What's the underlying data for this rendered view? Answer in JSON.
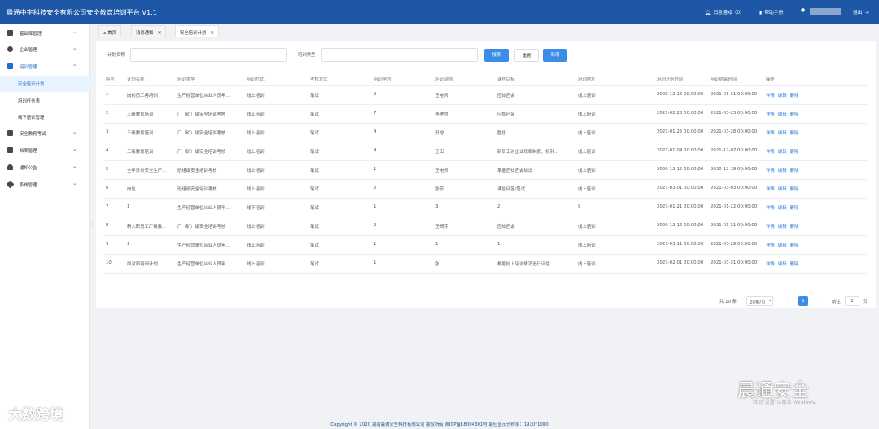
{
  "header": {
    "app_title": "晨通中宇科技安全有限公司安全教育培训平台 V1.1",
    "notifications": "消息通知（0）",
    "help": "帮助手册",
    "logout": "退出",
    "bg_color": "#1e57a6"
  },
  "sidebar": {
    "items": [
      {
        "label": "基础库管理",
        "icon": "database-icon"
      },
      {
        "label": "企业管理",
        "icon": "company-icon"
      },
      {
        "label": "培训管理",
        "icon": "training-icon",
        "open": true
      },
      {
        "label": "安全培训计划",
        "sub": true,
        "active": true
      },
      {
        "label": "培训任务表",
        "sub": true
      },
      {
        "label": "线下培训管理",
        "sub": true
      },
      {
        "label": "安全教育考试",
        "icon": "exam-icon"
      },
      {
        "label": "档案管理",
        "icon": "archive-icon"
      },
      {
        "label": "通知公告",
        "icon": "bell-icon"
      },
      {
        "label": "系统管理",
        "icon": "settings-icon"
      }
    ]
  },
  "tabs": [
    {
      "label": "首页",
      "icon": "home-icon"
    },
    {
      "label": "消息通知"
    },
    {
      "label": "安全培训计划",
      "active": true
    }
  ],
  "search": {
    "plan_name_label": "计划名称",
    "plan_name_value": "",
    "train_type_label": "培训类型",
    "train_type_value": "",
    "search_btn": "搜索",
    "reset_btn": "重置",
    "add_btn": "新增"
  },
  "table": {
    "columns": [
      "序号",
      "计划名称",
      "培训类型",
      "培训方式",
      "考核方式",
      "培训学时",
      "培训讲师",
      "课程目标",
      "培训地址",
      "培训开始时间",
      "培训结束时间",
      "操作"
    ],
    "rows": [
      [
        "1",
        "岗前员工再培训",
        "生产经营单位从业人员年...",
        "线上培训",
        "笔试",
        "2",
        "王老师",
        "应知应会",
        "线上培训",
        "2020-12-16 00:00:00",
        "2021-01-31 00:00:00"
      ],
      [
        "2",
        "三级教育培训",
        "厂（矿）级安全培训考核",
        "线上培训",
        "笔试",
        "7",
        "李老师",
        "应知应会",
        "线上培训",
        "2021-02-23 00:00:00",
        "2021-03-23 00:00:00"
      ],
      [
        "3",
        "三级教育培训",
        "厂（矿）级安全培训考核",
        "线上培训",
        "笔试",
        "4",
        "开总",
        "胜任",
        "线上培训",
        "2021-01-25 00:00:00",
        "2021-03-28 00:00:00"
      ],
      [
        "4",
        "三级教育培训",
        "厂（矿）级安全培训考核",
        "线上培训",
        "笔试",
        "4",
        "王五",
        "新员工对企业规章制度、权利...",
        "线上培训",
        "2021-01-04 00:00:00",
        "2021-12-07 00:00:00"
      ],
      [
        "5",
        "全年日常安全生产...",
        "班组级安全培训考核",
        "线上培训",
        "笔试",
        "1",
        "王老师",
        "掌握应知应会知识",
        "线上培训",
        "2020-12-15 00:00:00",
        "2020-12-18 00:00:00"
      ],
      [
        "6",
        "岗位",
        "班组级安全培训考核",
        "线上培训",
        "笔试",
        "2",
        "张安",
        "课堂问答/笔试",
        "线上培训",
        "2021-03-01 00:00:00",
        "2021-03-03 00:00:00"
      ],
      [
        "7",
        "1",
        "生产经营单位从业人员年...",
        "线下培训",
        "笔试",
        "1",
        "3",
        "2",
        "5",
        "2021-01-21 00:00:00",
        "2021-01-22 00:00:00"
      ],
      [
        "8",
        "新入职员工厂级教...",
        "厂（矿）级安全培训考核",
        "线上培训",
        "笔试",
        "2",
        "王晴宇",
        "应知应会",
        "线上培训",
        "2020-12-16 00:00:00",
        "2021-01-21 00:00:00"
      ],
      [
        "9",
        "1",
        "生产经营单位从业人员年...",
        "线上培训",
        "笔试",
        "1",
        "1",
        "1",
        "线上培训",
        "2021-03-11 00:00:00",
        "2021-03-29 00:00:00"
      ],
      [
        "10",
        "面对面培训计划",
        "生产经营单位从业人员年...",
        "线上培训",
        "笔试",
        "1",
        "张",
        "根据线上培训情况进行评估",
        "线上培训",
        "2021-02-01 00:00:00",
        "2021-03-31 00:00:00"
      ]
    ],
    "actions": [
      "详情",
      "编辑",
      "删除"
    ]
  },
  "pagination": {
    "total": "共 10 条",
    "page_size": "20条/页",
    "current_page": "1",
    "goto_label": "前往",
    "goto_value": "1",
    "page_suffix": "页"
  },
  "footer": {
    "text": "Copyright © 2020 湖南晨通安全科技有限公司 版权所有 湘ICP备18004301号 最佳显示分辨率：1920*1080"
  },
  "watermarks": {
    "left": "大数跨境",
    "right": "晨通安全",
    "os_hint": "转到\"设置\"以激活 Windows。"
  }
}
